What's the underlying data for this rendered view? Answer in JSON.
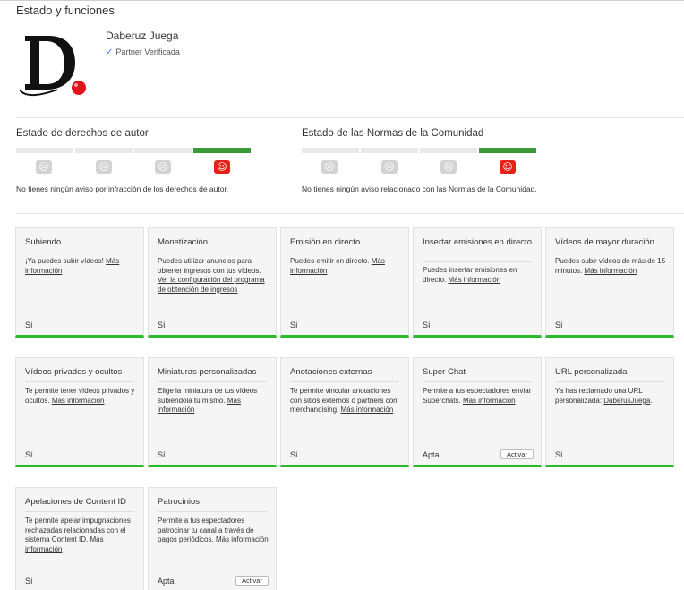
{
  "page_title": "Estado y funciones",
  "channel": {
    "name": "Daberuz Juega",
    "badge": "Partner Verificada"
  },
  "copyright": {
    "title": "Estado de derechos de autor",
    "message": "No tienes ningún aviso por infracción de los derechos de autor."
  },
  "community": {
    "title": "Estado de las Normas de la Comunidad",
    "message": "No tienes ningún aviso relacionado con las Normas de la Comunidad."
  },
  "colors": {
    "active_bar": "#3a9a3a",
    "active_face": "#e62117",
    "card_ok_border": "#2bbc2b",
    "verified_check": "#3b7bd6"
  },
  "features": [
    {
      "title": "Subiendo",
      "desc": "¡Ya puedes subir vídeos!",
      "link": "Más información",
      "status": "Sí"
    },
    {
      "title": "Monetización",
      "desc": "Puedes utilizar anuncios para obtener ingresos con tus vídeos.",
      "link": "Ver la configuración del programa de obtención de ingresos",
      "status": "Sí"
    },
    {
      "title": "Emisión en directo",
      "desc": "Puedes emitir en directo.",
      "link": "Más información",
      "status": "Sí"
    },
    {
      "title": "Insertar emisiones en directo",
      "desc": "Puedes insertar emisiones en directo.",
      "link": "Más información",
      "status": "Sí"
    },
    {
      "title": "Vídeos de mayor duración",
      "desc": "Puedes subir vídeos de más de 15 minutos.",
      "link": "Más información",
      "status": "Sí"
    },
    {
      "title": "Vídeos privados y ocultos",
      "desc": "Te permite tener vídeos privados y ocultos.",
      "link": "Más información",
      "status": "Sí"
    },
    {
      "title": "Miniaturas personalizadas",
      "desc": "Elige la miniatura de tus vídeos subiéndola tú mismo.",
      "link": "Más información",
      "status": "Sí"
    },
    {
      "title": "Anotaciones externas",
      "desc": "Te permite vincular anotaciones con sitios externos o partners con merchandising.",
      "link": "Más información",
      "status": "Sí"
    },
    {
      "title": "Super Chat",
      "desc": "Permite a tus espectadores enviar Superchats.",
      "link": "Más información",
      "status": "Apta",
      "button": "Activar"
    },
    {
      "title": "URL personalizada",
      "desc": "Ya has reclamado una URL personalizada:",
      "link": "DaberusJuega",
      "status": "Sí"
    },
    {
      "title": "Apelaciones de Content ID",
      "desc": "Te permite apelar impugnaciones rechazadas relacionadas con el sistema Content ID.",
      "link": "Más información",
      "status": "Sí"
    },
    {
      "title": "Patrocinios",
      "desc": "Permite a tus espectadores patrocinar tu canal a través de pagos periódicos.",
      "link": "Más información",
      "status": "Apta",
      "button": "Activar"
    }
  ]
}
